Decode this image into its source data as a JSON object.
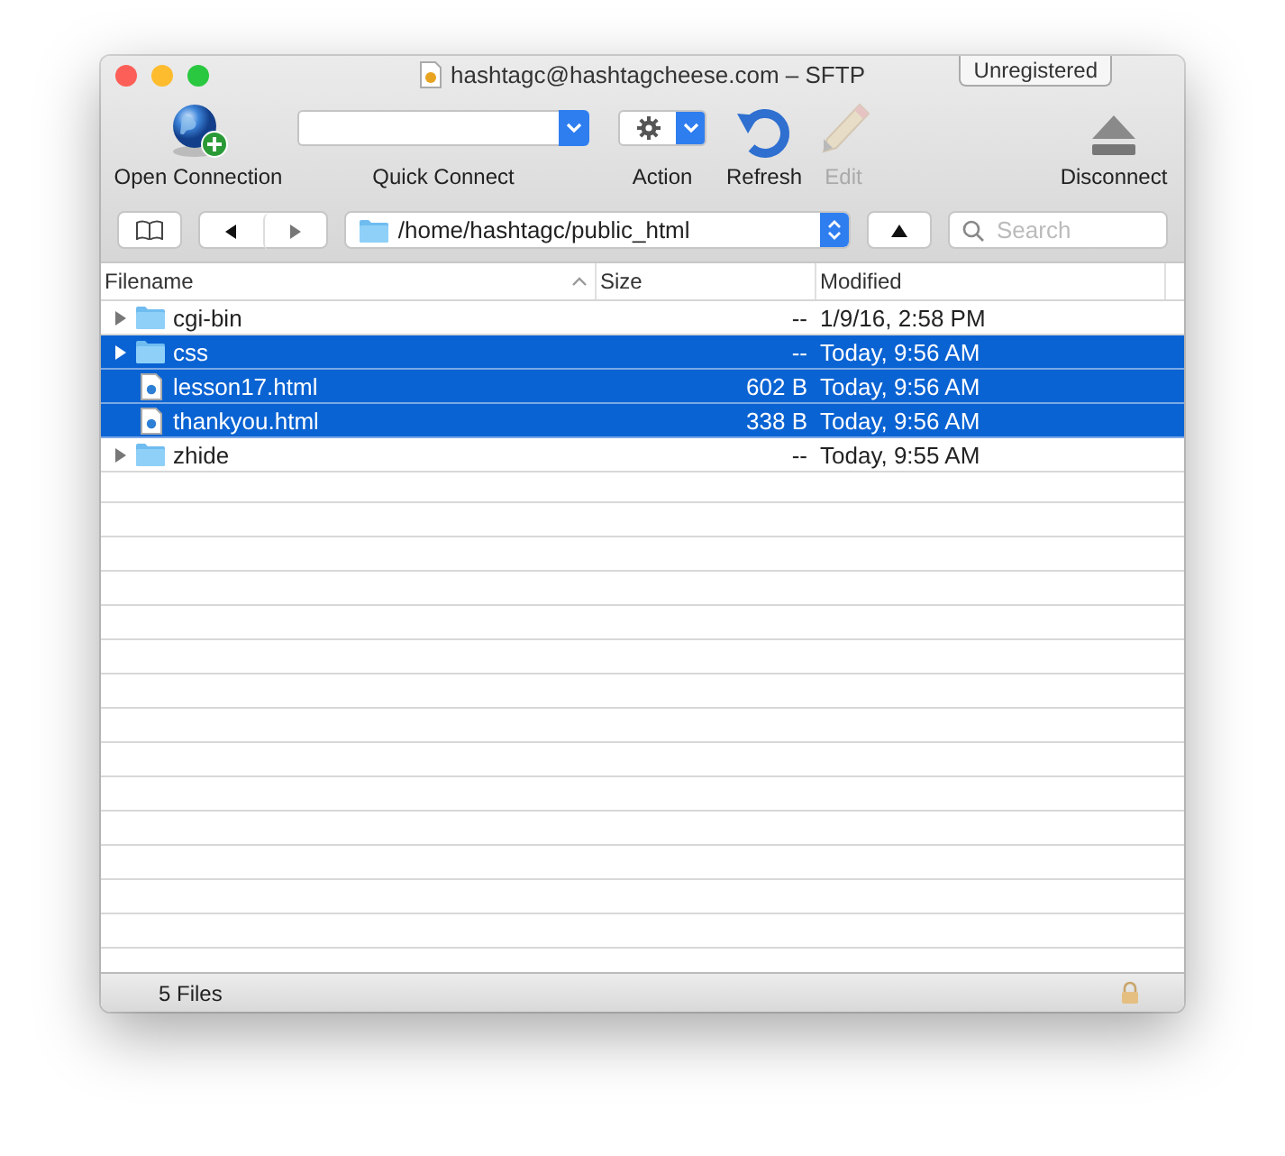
{
  "window": {
    "title": "hashtagc@hashtagcheese.com – SFTP",
    "badge": "Unregistered"
  },
  "toolbar": [
    {
      "kind": "open",
      "label": "Open Connection",
      "disabled": false
    },
    {
      "kind": "combo",
      "label": "Quick Connect",
      "disabled": false
    },
    {
      "kind": "action",
      "label": "Action",
      "disabled": false
    },
    {
      "kind": "refresh",
      "label": "Refresh",
      "disabled": false
    },
    {
      "kind": "edit",
      "label": "Edit",
      "disabled": true
    },
    {
      "kind": "disconnect",
      "label": "Disconnect",
      "disabled": false
    }
  ],
  "navigation": {
    "path": "/home/hashtagc/public_html",
    "search": {
      "placeholder": "Search"
    }
  },
  "table": {
    "columns": [
      {
        "label": "Filename",
        "sorted": true
      },
      {
        "label": "Size",
        "sorted": false
      },
      {
        "label": "Modified",
        "sorted": false
      }
    ],
    "rows": [
      {
        "kind": "folder",
        "name": "cgi-bin",
        "size": "--",
        "modified": "1/9/16, 2:58 PM",
        "selected": false,
        "expanded": false
      },
      {
        "kind": "folder",
        "name": "css",
        "size": "--",
        "modified": "Today, 9:56 AM",
        "selected": true,
        "expanded": false
      },
      {
        "kind": "file",
        "name": "lesson17.html",
        "size": "602 B",
        "modified": "Today, 9:56 AM",
        "selected": true
      },
      {
        "kind": "file",
        "name": "thankyou.html",
        "size": "338 B",
        "modified": "Today, 9:56 AM",
        "selected": true
      },
      {
        "kind": "folder",
        "name": "zhide",
        "size": "--",
        "modified": "Today, 9:55 AM",
        "selected": false,
        "expanded": false
      }
    ]
  },
  "status_bar": {
    "text": "5 Files"
  }
}
